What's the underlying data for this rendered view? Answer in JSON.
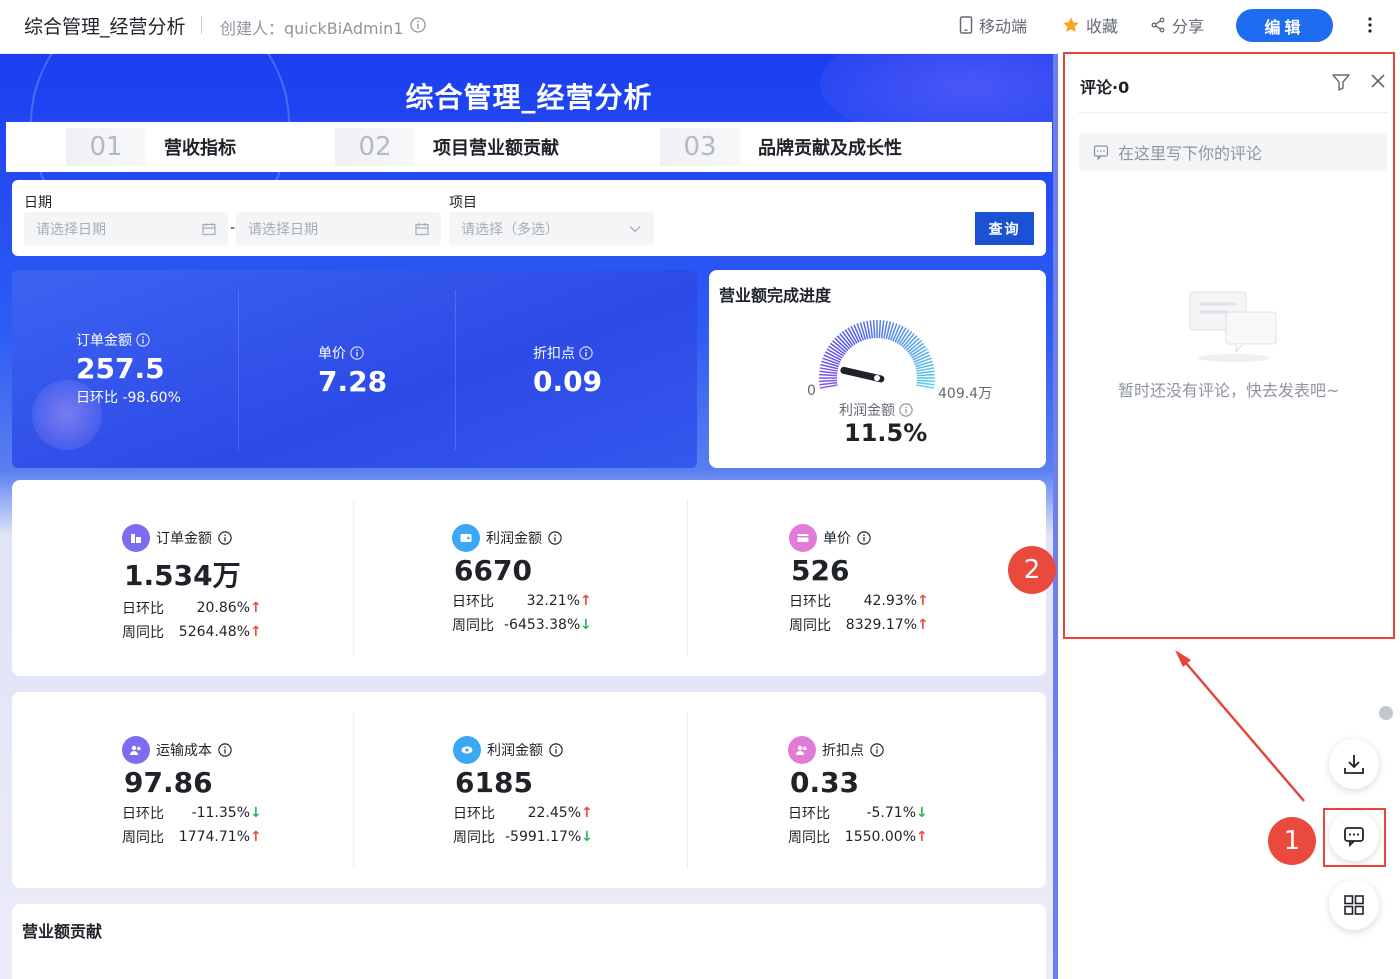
{
  "topbar": {
    "title": "综合管理_经营分析",
    "creator": "创建人：quickBiAdmin1",
    "mobile": "移动端",
    "favorite": "收藏",
    "share": "分享",
    "edit": "编辑"
  },
  "dashboard": {
    "title": "综合管理_经营分析",
    "tabs": [
      {
        "num": "01",
        "label": "营收指标"
      },
      {
        "num": "02",
        "label": "项目营业额贡献"
      },
      {
        "num": "03",
        "label": "品牌贡献及成长性"
      }
    ],
    "filters": {
      "date_label": "日期",
      "date_start_placeholder": "请选择日期",
      "date_sep": "-",
      "date_end_placeholder": "请选择日期",
      "project_label": "项目",
      "project_placeholder": "请选择（多选）",
      "query": "查询"
    },
    "kpi_blue": [
      {
        "label": "订单金额",
        "value": "257.5",
        "sub": "日环比  -98.60%"
      },
      {
        "label": "单价",
        "value": "7.28"
      },
      {
        "label": "折扣点",
        "value": "0.09"
      }
    ],
    "gauge": {
      "title": "营业额完成进度",
      "min": "0",
      "max": "409.4万",
      "label": "利润金额",
      "value": "11.5%",
      "progress": 0.115
    },
    "kpi_row1": [
      {
        "label": "订单金额",
        "icon": "store-icon",
        "color": "#7b6cf0",
        "value": "1.534万",
        "day_label": "日环比",
        "day": "20.86%",
        "day_dir": "up",
        "week_label": "周同比",
        "week": "5264.48%",
        "week_dir": "up"
      },
      {
        "label": "利润金额",
        "icon": "wallet-icon",
        "color": "#3aa8f5",
        "value": "6670",
        "day_label": "日环比",
        "day": "32.21%",
        "day_dir": "up",
        "week_label": "周同比",
        "week": "-6453.38%",
        "week_dir": "down"
      },
      {
        "label": "单价",
        "icon": "card-icon",
        "color": "#e27ad8",
        "value": "526",
        "day_label": "日环比",
        "day": "42.93%",
        "day_dir": "up",
        "week_label": "周同比",
        "week": "8329.17%",
        "week_dir": "up"
      }
    ],
    "kpi_row2": [
      {
        "label": "运输成本",
        "icon": "users-icon",
        "color": "#7b6cf0",
        "value": "97.86",
        "day_label": "日环比",
        "day": "-11.35%",
        "day_dir": "down",
        "week_label": "周同比",
        "week": "1774.71%",
        "week_dir": "up"
      },
      {
        "label": "利润金额",
        "icon": "eye-icon",
        "color": "#3aa8f5",
        "value": "6185",
        "day_label": "日环比",
        "day": "22.45%",
        "day_dir": "up",
        "week_label": "周同比",
        "week": "-5991.17%",
        "week_dir": "down"
      },
      {
        "label": "折扣点",
        "icon": "users-icon",
        "color": "#e27ad8",
        "value": "0.33",
        "day_label": "日环比",
        "day": "-5.71%",
        "day_dir": "down",
        "week_label": "周同比",
        "week": "1550.00%",
        "week_dir": "up"
      }
    ],
    "section_title": "营业额贡献"
  },
  "comments": {
    "title": "评论·0",
    "input_placeholder": "在这里写下你的评论",
    "empty": "暂时还没有评论，快去发表吧~"
  },
  "markers": {
    "one": "1",
    "two": "2"
  },
  "colors": {
    "accent": "#1e6cf0",
    "annotation": "#e5463a",
    "up": "#ef4b3f",
    "down": "#28b85a"
  }
}
